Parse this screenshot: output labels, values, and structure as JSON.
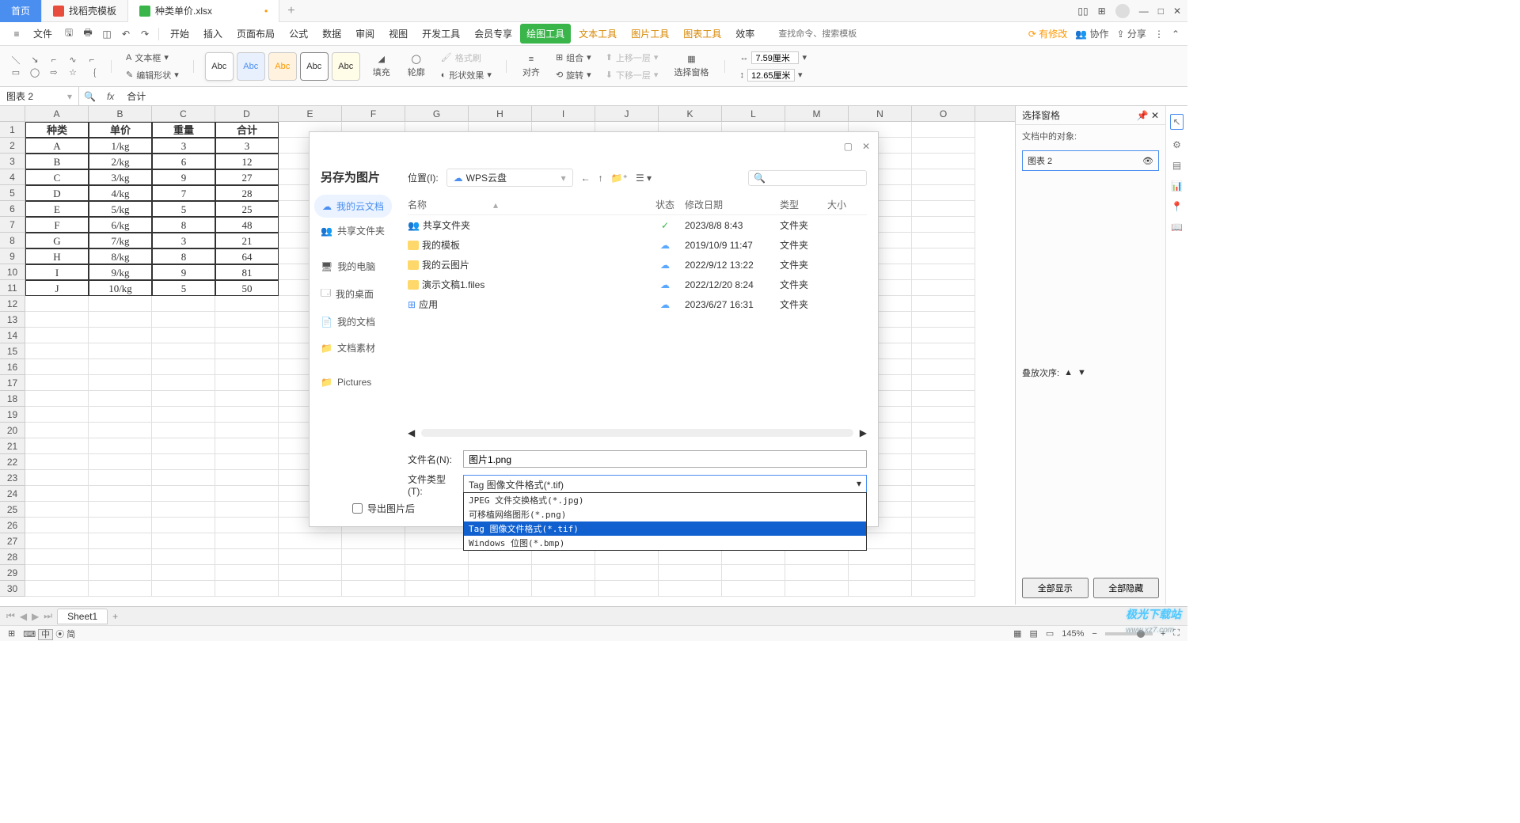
{
  "titlebar": {
    "home": "首页",
    "tab1": "找稻壳模板",
    "tab2": "种类单价.xlsx"
  },
  "menubar": {
    "file": "文件",
    "items": [
      "开始",
      "插入",
      "页面布局",
      "公式",
      "数据",
      "审阅",
      "视图",
      "开发工具",
      "会员专享",
      "绘图工具",
      "文本工具",
      "图片工具",
      "图表工具",
      "效率"
    ],
    "search_placeholder": "查找命令、搜索模板",
    "right": {
      "modify": "有修改",
      "coop": "协作",
      "share": "分享"
    }
  },
  "ribbon": {
    "textbox": "文本框",
    "editshape": "编辑形状",
    "abc": "Abc",
    "fill": "填充",
    "outline": "轮廓",
    "effect": "形状效果",
    "format_painter": "格式刷",
    "align": "对齐",
    "group": "组合",
    "rotate": "旋转",
    "move_up": "上移一层",
    "move_down": "下移一层",
    "select_pane": "选择窗格",
    "w": "7.59厘米",
    "h": "12.65厘米"
  },
  "namebox": "图表 2",
  "fx": "合计",
  "sheet": {
    "cols": [
      "A",
      "B",
      "C",
      "D",
      "E",
      "F",
      "G",
      "H",
      "I",
      "J",
      "K",
      "L",
      "M",
      "N",
      "O"
    ],
    "header": [
      "种类",
      "单价",
      "重量",
      "合计"
    ],
    "data": [
      [
        "A",
        "1/kg",
        "3",
        "3"
      ],
      [
        "B",
        "2/kg",
        "6",
        "12"
      ],
      [
        "C",
        "3/kg",
        "9",
        "27"
      ],
      [
        "D",
        "4/kg",
        "7",
        "28"
      ],
      [
        "E",
        "5/kg",
        "5",
        "25"
      ],
      [
        "F",
        "6/kg",
        "8",
        "48"
      ],
      [
        "G",
        "7/kg",
        "3",
        "21"
      ],
      [
        "H",
        "8/kg",
        "8",
        "64"
      ],
      [
        "I",
        "9/kg",
        "9",
        "81"
      ],
      [
        "J",
        "10/kg",
        "5",
        "50"
      ]
    ]
  },
  "dialog": {
    "title": "另存为图片",
    "loc_label": "位置(I):",
    "loc_value": "WPS云盘",
    "side": {
      "cloud": "我的云文档",
      "share": "共享文件夹",
      "pc": "我的电脑",
      "desktop": "我的桌面",
      "docs": "我的文档",
      "material": "文档素材",
      "pictures": "Pictures"
    },
    "cols": {
      "name": "名称",
      "status": "状态",
      "date": "修改日期",
      "type": "类型",
      "size": "大小"
    },
    "rows": [
      {
        "name": "共享文件夹",
        "icon": "share",
        "status": "ok",
        "date": "2023/8/8 8:43",
        "type": "文件夹"
      },
      {
        "name": "我的模板",
        "icon": "folder",
        "status": "cloud",
        "date": "2019/10/9 11:47",
        "type": "文件夹"
      },
      {
        "name": "我的云图片",
        "icon": "folder",
        "status": "cloud",
        "date": "2022/9/12 13:22",
        "type": "文件夹"
      },
      {
        "name": "演示文稿1.files",
        "icon": "folder",
        "status": "cloud",
        "date": "2022/12/20 8:24",
        "type": "文件夹"
      },
      {
        "name": "应用",
        "icon": "app",
        "status": "cloud",
        "date": "2023/6/27 16:31",
        "type": "文件夹"
      }
    ],
    "filename_label": "文件名(N):",
    "filename": "图片1.png",
    "filetype_label": "文件类型(T):",
    "filetype": "Tag 图像文件格式(*.tif)",
    "export_label": "导出图片后",
    "dropdown": [
      "JPEG 文件交换格式(*.jpg)",
      "可移植网络图形(*.png)",
      "Tag 图像文件格式(*.tif)",
      "Windows 位图(*.bmp)"
    ],
    "dropdown_selected": 2
  },
  "right_panel": {
    "title": "选择窗格",
    "sub": "文档中的对象:",
    "item": "图表 2",
    "order": "叠放次序:",
    "btn1": "全部显示",
    "btn2": "全部隐藏"
  },
  "sheettab": "Sheet1",
  "statusbar": {
    "left": "中",
    "zoom": "145%"
  },
  "watermark": {
    "brand": "极光下载站",
    "url": "www.xz7.com"
  }
}
